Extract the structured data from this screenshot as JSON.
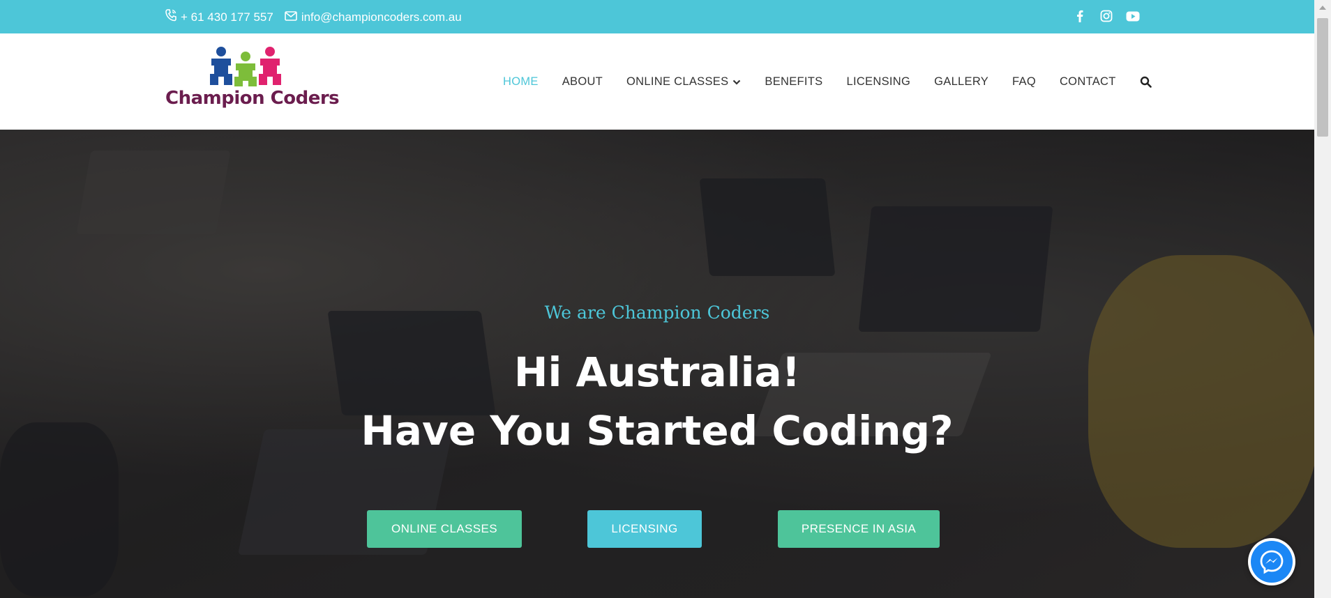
{
  "topbar": {
    "phone": "+ 61 430 177 557",
    "email": "info@championcoders.com.au",
    "icons": [
      "phone-icon",
      "envelope-icon",
      "facebook-icon",
      "instagram-icon",
      "youtube-icon"
    ],
    "color": "#4dc6d8"
  },
  "header": {
    "logo_text": "Champion Coders",
    "nav": [
      {
        "label": "HOME",
        "active": true
      },
      {
        "label": "ABOUT"
      },
      {
        "label": "ONLINE CLASSES",
        "dropdown": true
      },
      {
        "label": "BENEFITS"
      },
      {
        "label": "LICENSING"
      },
      {
        "label": "GALLERY"
      },
      {
        "label": "FAQ"
      },
      {
        "label": "CONTACT"
      }
    ],
    "search_icon": "search-icon"
  },
  "hero": {
    "tagline": "We are Champion Coders",
    "headline_line1": "Hi Australia!",
    "headline_line2": "Have You Started Coding?",
    "buttons": [
      {
        "label": "ONLINE CLASSES",
        "color": "#4ec49a"
      },
      {
        "label": "LICENSING",
        "color": "#4dc6d8"
      },
      {
        "label": "PRESENCE IN ASIA",
        "color": "#4ec49a"
      }
    ]
  },
  "messenger": {
    "icon": "messenger-icon",
    "color": "#1b87f5"
  }
}
